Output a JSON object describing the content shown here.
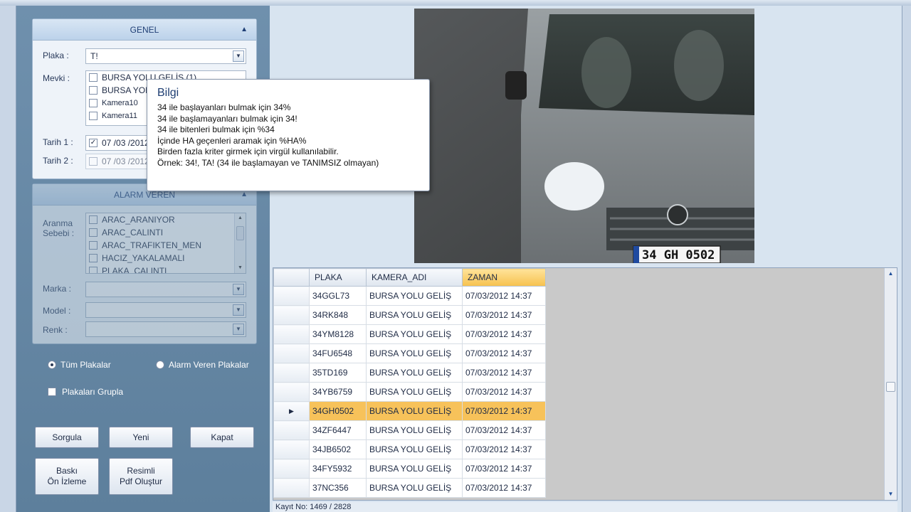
{
  "genel": {
    "title": "GENEL",
    "plaka_label": "Plaka :",
    "plaka_value": "T!",
    "mevki_label": "Mevki :",
    "mevki_items": [
      "BURSA YOLU GELİŞ (1)",
      "BURSA YOLU",
      "Kamera10",
      "Kamera11"
    ],
    "tarih1_label": "Tarih 1 :",
    "tarih1_value": "07 /03 /2012",
    "tarih2_label": "Tarih 2 :",
    "tarih2_value": "07 /03 /2012"
  },
  "alarm": {
    "title": "ALARM VEREN",
    "sebep_label_1": "Aranma",
    "sebep_label_2": "Sebebi :",
    "sebep_items": [
      "ARAC_ARANIYOR",
      "ARAC_CALINTI",
      "ARAC_TRAFIKTEN_MEN",
      "HACIZ_YAKALAMALI",
      "PLAKA_CALINTI"
    ],
    "marka_label": "Marka :",
    "model_label": "Model :",
    "renk_label": "Renk :"
  },
  "options": {
    "tum_plakalar": "Tüm Plakalar",
    "alarm_veren_plakalar": "Alarm Veren Plakalar",
    "grupla": "Plakaları Grupla"
  },
  "buttons": {
    "sorgula": "Sorgula",
    "yeni": "Yeni",
    "kapat": "Kapat",
    "baski": "Baskı\nÖn İzleme",
    "pdf": "Resimli\nPdf Oluştur"
  },
  "tooltip": {
    "title": "Bilgi",
    "lines": [
      "34 ile başlayanları bulmak için 34%",
      "34 ile başlamayanları bulmak için 34!",
      "34 ile bitenleri bulmak için %34",
      "İçinde HA geçenleri aramak için %HA%",
      "Birden fazla kriter girmek için virgül kullanılabilir.",
      "Örnek: 34!, TA! (34 ile başlamayan ve TANIMSIZ olmayan)"
    ]
  },
  "image": {
    "plate_text": "34 GH 0502"
  },
  "grid": {
    "columns": [
      "PLAKA",
      "KAMERA_ADI",
      "ZAMAN"
    ],
    "rows": [
      [
        "34GGL73",
        "BURSA YOLU GELİŞ",
        "07/03/2012 14:37"
      ],
      [
        "34RK848",
        "BURSA YOLU GELİŞ",
        "07/03/2012 14:37"
      ],
      [
        "34YM8128",
        "BURSA YOLU GELİŞ",
        "07/03/2012 14:37"
      ],
      [
        "34FU6548",
        "BURSA YOLU GELİŞ",
        "07/03/2012 14:37"
      ],
      [
        "35TD169",
        "BURSA YOLU GELİŞ",
        "07/03/2012 14:37"
      ],
      [
        "34YB6759",
        "BURSA YOLU GELİŞ",
        "07/03/2012 14:37"
      ],
      [
        "34GH0502",
        "BURSA YOLU GELİŞ",
        "07/03/2012 14:37"
      ],
      [
        "34ZF6447",
        "BURSA YOLU GELİŞ",
        "07/03/2012 14:37"
      ],
      [
        "34JB6502",
        "BURSA YOLU GELİŞ",
        "07/03/2012 14:37"
      ],
      [
        "34FY5932",
        "BURSA YOLU GELİŞ",
        "07/03/2012 14:37"
      ],
      [
        "37NC356",
        "BURSA YOLU GELİŞ",
        "07/03/2012 14:37"
      ]
    ],
    "selected_index": 6
  },
  "status": {
    "kayit": "Kayıt No: 1469 / 2828"
  },
  "colors": {
    "selected_row": "#f7c25a",
    "panel_bg": "#5d7f9c"
  }
}
